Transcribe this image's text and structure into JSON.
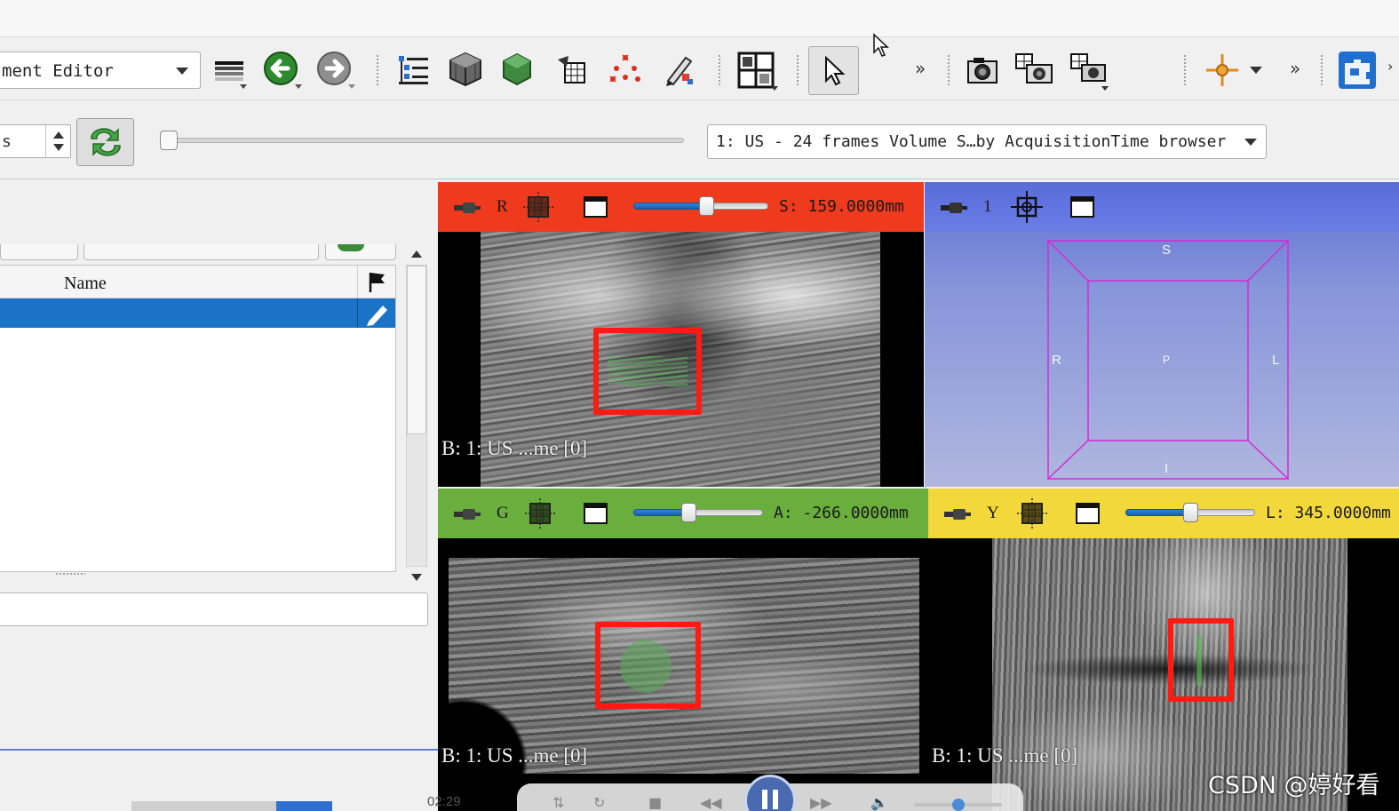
{
  "toolbar": {
    "module_selector": "ment Editor",
    "overflow_label": "»",
    "icons": [
      "window-level-icon",
      "back-arrow-icon",
      "forward-arrow-icon",
      "data-tree-icon",
      "volume-cube-icon",
      "models-icon",
      "segment-grid-icon",
      "markups-icon",
      "editor-pen-icon",
      "layout-icon",
      "pointer-icon",
      "screenshot-icon",
      "scene-view-icon",
      "capture-icon",
      "crosshair-icon",
      "extension-manager-icon"
    ]
  },
  "sequence_bar": {
    "spin_value": "s",
    "browser_selector": "1: US - 24 frames Volume S…by AcquisitionTime browser"
  },
  "left_panel": {
    "tree": {
      "column_name": "Name"
    }
  },
  "views": {
    "red": {
      "letter": "R",
      "offset": "S: 159.0000mm",
      "label": "B: 1: US ...me [0]",
      "slider": 0.55
    },
    "green": {
      "letter": "G",
      "offset": "A: -266.0000mm",
      "label": "B: 1: US ...me [0]",
      "slider": 0.42
    },
    "yellow": {
      "letter": "Y",
      "offset": "L: 345.0000mm",
      "label": "B: 1: US ...me [0]",
      "slider": 0.5
    },
    "threed": {
      "letter": "1",
      "axis_labels": {
        "superior": "S",
        "right": "R",
        "posterior": "P",
        "left": "L",
        "inferior": "I"
      }
    }
  },
  "player": {
    "time": "02:29",
    "progress": 0.72,
    "volume": 0.5
  },
  "watermark": "CSDN @婷好看",
  "colors": {
    "red_view": "#ef3a1d",
    "green_view": "#6aae3e",
    "yellow_view": "#f2d83a",
    "threed_view": "#5a6cd8",
    "selection": "#1a73c6",
    "roi": "#ff1a12"
  }
}
